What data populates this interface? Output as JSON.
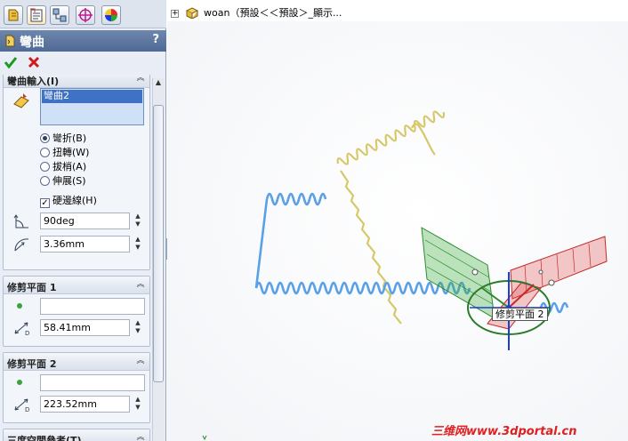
{
  "panel": {
    "title": "彎曲",
    "help": "?",
    "group_bend_bodies": {
      "title": "彎曲輸入(I)",
      "selected_body": "彎曲2",
      "bend_types": [
        {
          "label": "彎折(B)",
          "checked": true
        },
        {
          "label": "扭轉(W)",
          "checked": false
        },
        {
          "label": "拔梢(A)",
          "checked": false
        },
        {
          "label": "伸展(S)",
          "checked": false
        }
      ],
      "hard_edges_label": "硬邊線(H)",
      "angle_value": "90deg",
      "radius_value": "3.36mm"
    },
    "trim_plane_1": {
      "title": "修剪平面 1",
      "reference_value": "",
      "distance_value": "58.41mm"
    },
    "trim_plane_2": {
      "title": "修剪平面 2",
      "reference_value": "",
      "distance_value": "223.52mm"
    },
    "triad": {
      "title": "三度空間參考(T)"
    }
  },
  "tree": {
    "root_text": "woan（預設＜＜預設＞_顯示..."
  },
  "viewport": {
    "trim_tag": "修剪平面 2"
  },
  "watermark": "三维网www.3dportal.cn",
  "colors": {
    "accent": "#4f6a95",
    "selection": "#3f72c4",
    "spring_blue": "#5aa0e6",
    "spring_yellow": "#d6c86a",
    "plane_green": "#3fae3f",
    "plane_red": "#e24c4c"
  }
}
